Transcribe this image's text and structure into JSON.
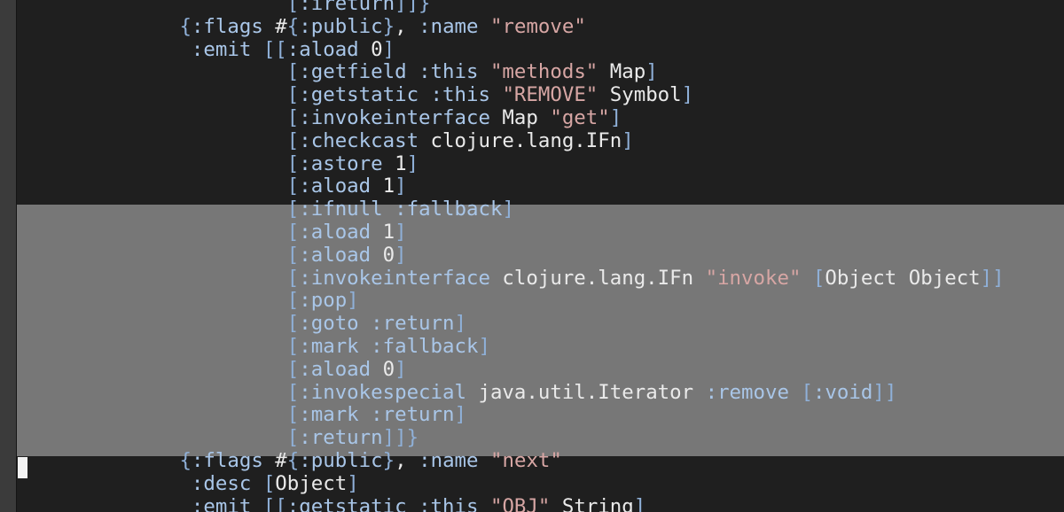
{
  "editor": {
    "colors": {
      "background": "#1f1f1f",
      "selection": "#777777",
      "keyword": "#a9c6e8",
      "string": "#d7a6a4",
      "text": "#eaeaea",
      "cursor": "#f2f2f2"
    },
    "lines": [
      [
        {
          "t": "            ",
          "c": "p"
        },
        {
          "t": "[",
          "c": "br"
        },
        {
          "t": ":ireturn",
          "c": "sym"
        },
        {
          "t": "]]}",
          "c": "br"
        }
      ],
      [
        {
          "t": "   ",
          "c": "p"
        },
        {
          "t": "{",
          "c": "br"
        },
        {
          "t": ":flags",
          "c": "sym"
        },
        {
          "t": " #",
          "c": "p"
        },
        {
          "t": "{",
          "c": "br"
        },
        {
          "t": ":public",
          "c": "sym"
        },
        {
          "t": "}",
          "c": "br"
        },
        {
          "t": ", ",
          "c": "p"
        },
        {
          "t": ":name",
          "c": "sym"
        },
        {
          "t": " ",
          "c": "p"
        },
        {
          "t": "\"remove\"",
          "c": "str"
        }
      ],
      [
        {
          "t": "    ",
          "c": "p"
        },
        {
          "t": ":emit",
          "c": "sym"
        },
        {
          "t": " ",
          "c": "p"
        },
        {
          "t": "[[",
          "c": "br"
        },
        {
          "t": ":aload",
          "c": "sym"
        },
        {
          "t": " 0",
          "c": "p"
        },
        {
          "t": "]",
          "c": "br"
        }
      ],
      [
        {
          "t": "            ",
          "c": "p"
        },
        {
          "t": "[",
          "c": "br"
        },
        {
          "t": ":getfield",
          "c": "sym"
        },
        {
          "t": " ",
          "c": "p"
        },
        {
          "t": ":this",
          "c": "sym"
        },
        {
          "t": " ",
          "c": "p"
        },
        {
          "t": "\"methods\"",
          "c": "str"
        },
        {
          "t": " Map",
          "c": "p"
        },
        {
          "t": "]",
          "c": "br"
        }
      ],
      [
        {
          "t": "            ",
          "c": "p"
        },
        {
          "t": "[",
          "c": "br"
        },
        {
          "t": ":getstatic",
          "c": "sym"
        },
        {
          "t": " ",
          "c": "p"
        },
        {
          "t": ":this",
          "c": "sym"
        },
        {
          "t": " ",
          "c": "p"
        },
        {
          "t": "\"REMOVE\"",
          "c": "str"
        },
        {
          "t": " Symbol",
          "c": "p"
        },
        {
          "t": "]",
          "c": "br"
        }
      ],
      [
        {
          "t": "            ",
          "c": "p"
        },
        {
          "t": "[",
          "c": "br"
        },
        {
          "t": ":invokeinterface",
          "c": "sym"
        },
        {
          "t": " Map ",
          "c": "p"
        },
        {
          "t": "\"get\"",
          "c": "str"
        },
        {
          "t": "]",
          "c": "br"
        }
      ],
      [
        {
          "t": "            ",
          "c": "p"
        },
        {
          "t": "[",
          "c": "br"
        },
        {
          "t": ":checkcast",
          "c": "sym"
        },
        {
          "t": " clojure.lang.IFn",
          "c": "p"
        },
        {
          "t": "]",
          "c": "br"
        }
      ],
      [
        {
          "t": "            ",
          "c": "p"
        },
        {
          "t": "[",
          "c": "br"
        },
        {
          "t": ":astore",
          "c": "sym"
        },
        {
          "t": " 1",
          "c": "p"
        },
        {
          "t": "]",
          "c": "br"
        }
      ],
      [
        {
          "t": "            ",
          "c": "p"
        },
        {
          "t": "[",
          "c": "br"
        },
        {
          "t": ":aload",
          "c": "sym"
        },
        {
          "t": " 1",
          "c": "p"
        },
        {
          "t": "]",
          "c": "br"
        }
      ],
      [
        {
          "t": "            ",
          "c": "p"
        },
        {
          "t": "[",
          "c": "br"
        },
        {
          "t": ":ifnull",
          "c": "sym"
        },
        {
          "t": " ",
          "c": "p"
        },
        {
          "t": ":fallback",
          "c": "sym"
        },
        {
          "t": "]",
          "c": "br"
        }
      ],
      [
        {
          "t": "            ",
          "c": "p"
        },
        {
          "t": "[",
          "c": "br"
        },
        {
          "t": ":aload",
          "c": "sym"
        },
        {
          "t": " 1",
          "c": "p"
        },
        {
          "t": "]",
          "c": "br"
        }
      ],
      [
        {
          "t": "            ",
          "c": "p"
        },
        {
          "t": "[",
          "c": "br"
        },
        {
          "t": ":aload",
          "c": "sym"
        },
        {
          "t": " 0",
          "c": "p"
        },
        {
          "t": "]",
          "c": "br"
        }
      ],
      [
        {
          "t": "            ",
          "c": "p"
        },
        {
          "t": "[",
          "c": "br"
        },
        {
          "t": ":invokeinterface",
          "c": "sym"
        },
        {
          "t": " clojure.lang.IFn ",
          "c": "p"
        },
        {
          "t": "\"invoke\"",
          "c": "str"
        },
        {
          "t": " ",
          "c": "p"
        },
        {
          "t": "[",
          "c": "br"
        },
        {
          "t": "Object Object",
          "c": "p"
        },
        {
          "t": "]]",
          "c": "br"
        }
      ],
      [
        {
          "t": "            ",
          "c": "p"
        },
        {
          "t": "[",
          "c": "br"
        },
        {
          "t": ":pop",
          "c": "sym"
        },
        {
          "t": "]",
          "c": "br"
        }
      ],
      [
        {
          "t": "            ",
          "c": "p"
        },
        {
          "t": "[",
          "c": "br"
        },
        {
          "t": ":goto",
          "c": "sym"
        },
        {
          "t": " ",
          "c": "p"
        },
        {
          "t": ":return",
          "c": "sym"
        },
        {
          "t": "]",
          "c": "br"
        }
      ],
      [
        {
          "t": "            ",
          "c": "p"
        },
        {
          "t": "[",
          "c": "br"
        },
        {
          "t": ":mark",
          "c": "sym"
        },
        {
          "t": " ",
          "c": "p"
        },
        {
          "t": ":fallback",
          "c": "sym"
        },
        {
          "t": "]",
          "c": "br"
        }
      ],
      [
        {
          "t": "            ",
          "c": "p"
        },
        {
          "t": "[",
          "c": "br"
        },
        {
          "t": ":aload",
          "c": "sym"
        },
        {
          "t": " 0",
          "c": "p"
        },
        {
          "t": "]",
          "c": "br"
        }
      ],
      [
        {
          "t": "            ",
          "c": "p"
        },
        {
          "t": "[",
          "c": "br"
        },
        {
          "t": ":invokespecial",
          "c": "sym"
        },
        {
          "t": " java.util.Iterator ",
          "c": "p"
        },
        {
          "t": ":remove",
          "c": "sym"
        },
        {
          "t": " ",
          "c": "p"
        },
        {
          "t": "[",
          "c": "br"
        },
        {
          "t": ":void",
          "c": "sym"
        },
        {
          "t": "]]",
          "c": "br"
        }
      ],
      [
        {
          "t": "            ",
          "c": "p"
        },
        {
          "t": "[",
          "c": "br"
        },
        {
          "t": ":mark",
          "c": "sym"
        },
        {
          "t": " ",
          "c": "p"
        },
        {
          "t": ":return",
          "c": "sym"
        },
        {
          "t": "]",
          "c": "br"
        }
      ],
      [
        {
          "t": "            ",
          "c": "p"
        },
        {
          "t": "[",
          "c": "br"
        },
        {
          "t": ":return",
          "c": "sym"
        },
        {
          "t": "]]}",
          "c": "br"
        }
      ],
      [
        {
          "t": "   ",
          "c": "p"
        },
        {
          "t": "{",
          "c": "br"
        },
        {
          "t": ":flags",
          "c": "sym"
        },
        {
          "t": " #",
          "c": "p"
        },
        {
          "t": "{",
          "c": "br"
        },
        {
          "t": ":public",
          "c": "sym"
        },
        {
          "t": "}",
          "c": "br"
        },
        {
          "t": ", ",
          "c": "p"
        },
        {
          "t": ":name",
          "c": "sym"
        },
        {
          "t": " ",
          "c": "p"
        },
        {
          "t": "\"next\"",
          "c": "str"
        }
      ],
      [
        {
          "t": "    ",
          "c": "p"
        },
        {
          "t": ":desc",
          "c": "sym"
        },
        {
          "t": " ",
          "c": "p"
        },
        {
          "t": "[",
          "c": "br"
        },
        {
          "t": "Object",
          "c": "p"
        },
        {
          "t": "]",
          "c": "br"
        }
      ],
      [
        {
          "t": "    ",
          "c": "p"
        },
        {
          "t": ":emit",
          "c": "sym"
        },
        {
          "t": " ",
          "c": "p"
        },
        {
          "t": "[[",
          "c": "br"
        },
        {
          "t": ":getstatic",
          "c": "sym"
        },
        {
          "t": " ",
          "c": "p"
        },
        {
          "t": ":this",
          "c": "sym"
        },
        {
          "t": " ",
          "c": "p"
        },
        {
          "t": "\"OBJ\"",
          "c": "str"
        },
        {
          "t": " String",
          "c": "p"
        },
        {
          "t": "]",
          "c": "br"
        }
      ]
    ]
  }
}
